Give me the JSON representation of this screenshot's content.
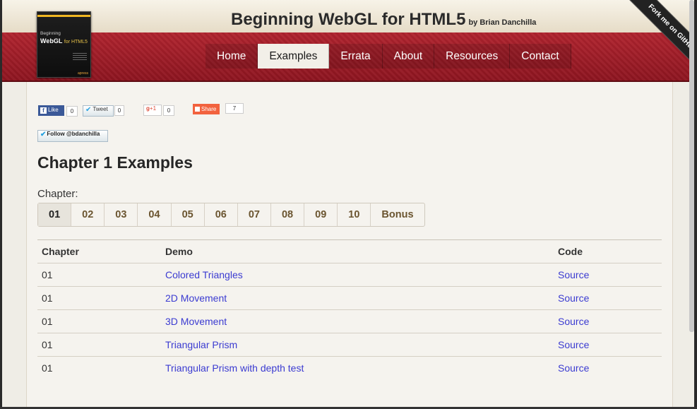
{
  "header": {
    "title": "Beginning WebGL for HTML5",
    "byline": "by Brian Danchilla",
    "book_cover": {
      "line1": "Beginning",
      "line2": "WebGL",
      "line2b": "for HTML5",
      "publisher": "apress"
    }
  },
  "nav": {
    "items": [
      {
        "label": "Home"
      },
      {
        "label": "Examples"
      },
      {
        "label": "Errata"
      },
      {
        "label": "About"
      },
      {
        "label": "Resources"
      },
      {
        "label": "Contact"
      }
    ],
    "active": "Examples"
  },
  "ribbon": {
    "label": "Fork me on GitHub"
  },
  "social": {
    "fb_label": "Like",
    "fb_count": "0",
    "tweet_label": "Tweet",
    "tweet_count": "0",
    "gplus_label": "+1",
    "gplus_count": "0",
    "share_label": "Share",
    "share_count": "7",
    "follow_label": "Follow @bdanchilla"
  },
  "page": {
    "heading": "Chapter 1 Examples",
    "chapter_label": "Chapter:"
  },
  "chapters": [
    "01",
    "02",
    "03",
    "04",
    "05",
    "06",
    "07",
    "08",
    "09",
    "10",
    "Bonus"
  ],
  "active_chapter": "01",
  "table": {
    "headers": {
      "chapter": "Chapter",
      "demo": "Demo",
      "code": "Code"
    },
    "rows": [
      {
        "chapter": "01",
        "demo": "Colored Triangles",
        "code": "Source"
      },
      {
        "chapter": "01",
        "demo": "2D Movement",
        "code": "Source"
      },
      {
        "chapter": "01",
        "demo": "3D Movement",
        "code": "Source"
      },
      {
        "chapter": "01",
        "demo": "Triangular Prism",
        "code": "Source"
      },
      {
        "chapter": "01",
        "demo": "Triangular Prism with depth test",
        "code": "Source"
      }
    ]
  }
}
